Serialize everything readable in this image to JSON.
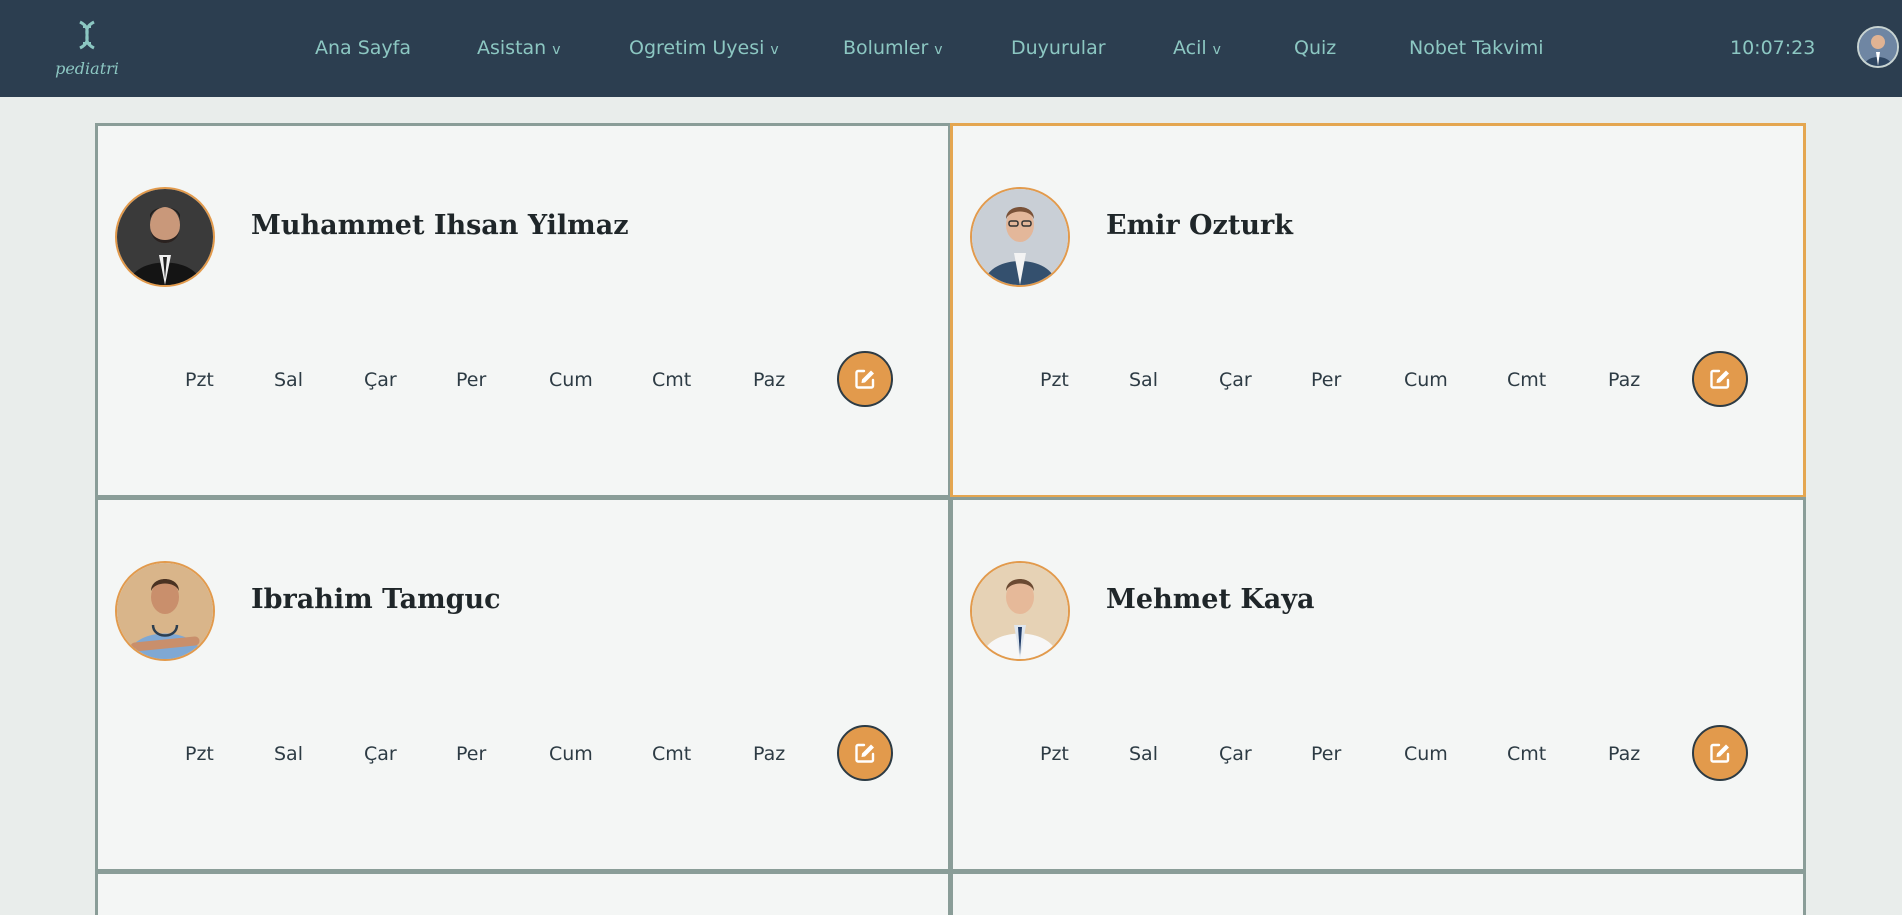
{
  "app": {
    "logo_text": "pediatri",
    "clock": "10:07:23"
  },
  "nav": [
    {
      "label": "Ana Sayfa",
      "caret": ""
    },
    {
      "label": "Asistan",
      "caret": "v"
    },
    {
      "label": "Ogretim Uyesi",
      "caret": "v"
    },
    {
      "label": "Bolumler",
      "caret": "v"
    },
    {
      "label": "Duyurular",
      "caret": ""
    },
    {
      "label": "Acil",
      "caret": "v"
    },
    {
      "label": "Quiz",
      "caret": ""
    },
    {
      "label": "Nobet Takvimi",
      "caret": ""
    }
  ],
  "days": [
    "Pzt",
    "Sal",
    "Çar",
    "Per",
    "Cum",
    "Cmt",
    "Paz"
  ],
  "cards": [
    {
      "name": "Muhammet Ihsan Yilmaz",
      "avatar": "doctor-1-photo"
    },
    {
      "name": "Emir Ozturk",
      "avatar": "doctor-2-photo",
      "highlighted": true
    },
    {
      "name": "Ibrahim Tamguc",
      "avatar": "doctor-3-photo"
    },
    {
      "name": "Mehmet Kaya",
      "avatar": "doctor-4-photo"
    }
  ],
  "icons": {
    "edit": "edit-icon",
    "logo": "dna-logo-icon"
  },
  "colors": {
    "topbar": "#2c3e50",
    "accent": "#e29a4c",
    "nav_text": "#8cc7c2",
    "card_border": "#8a9d98"
  }
}
